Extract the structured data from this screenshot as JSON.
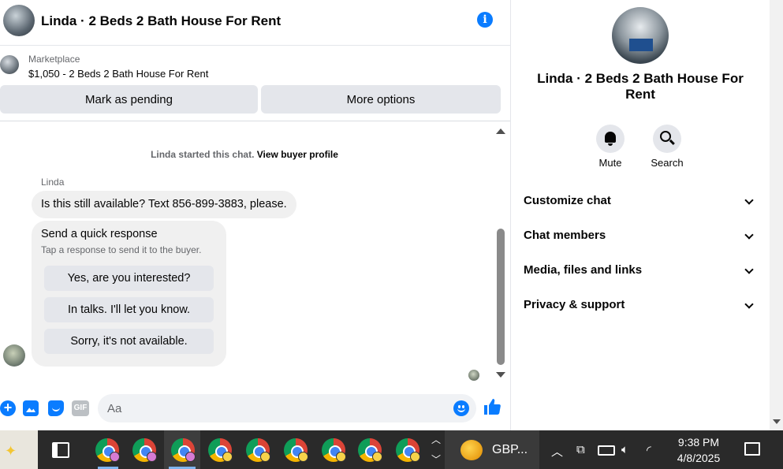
{
  "header": {
    "title": "Linda · 2 Beds 2 Bath House For Rent"
  },
  "marketplace": {
    "label": "Marketplace",
    "item": "$1,050 - 2 Beds 2 Bath House For Rent"
  },
  "actions": {
    "pending": "Mark as pending",
    "more": "More options"
  },
  "conversation": {
    "started_prefix": "Linda started this chat.",
    "started_link": "View buyer profile",
    "sender": "Linda",
    "message": "Is this still available? Text 856-899-3883, please.",
    "quick_title": "Send a quick response",
    "quick_subtitle": "Tap a response to send it to the buyer.",
    "quick_replies": [
      "Yes, are you interested?",
      "In talks. I'll let you know.",
      "Sorry, it's not available."
    ]
  },
  "composer": {
    "placeholder": "Aa",
    "gif": "GIF"
  },
  "info_panel": {
    "name": "Linda · 2 Beds 2 Bath House For Rent",
    "mute": "Mute",
    "search": "Search",
    "sections": [
      "Customize chat",
      "Chat members",
      "Media, files and links",
      "Privacy & support"
    ]
  },
  "taskbar": {
    "currency": "GBP...",
    "time": "9:38 PM",
    "date": "4/8/2025"
  },
  "colors": {
    "accent": "#0a7cff",
    "bubble": "#f0f0f0",
    "button": "#e4e6eb",
    "taskbar": "#2a2a2a"
  }
}
